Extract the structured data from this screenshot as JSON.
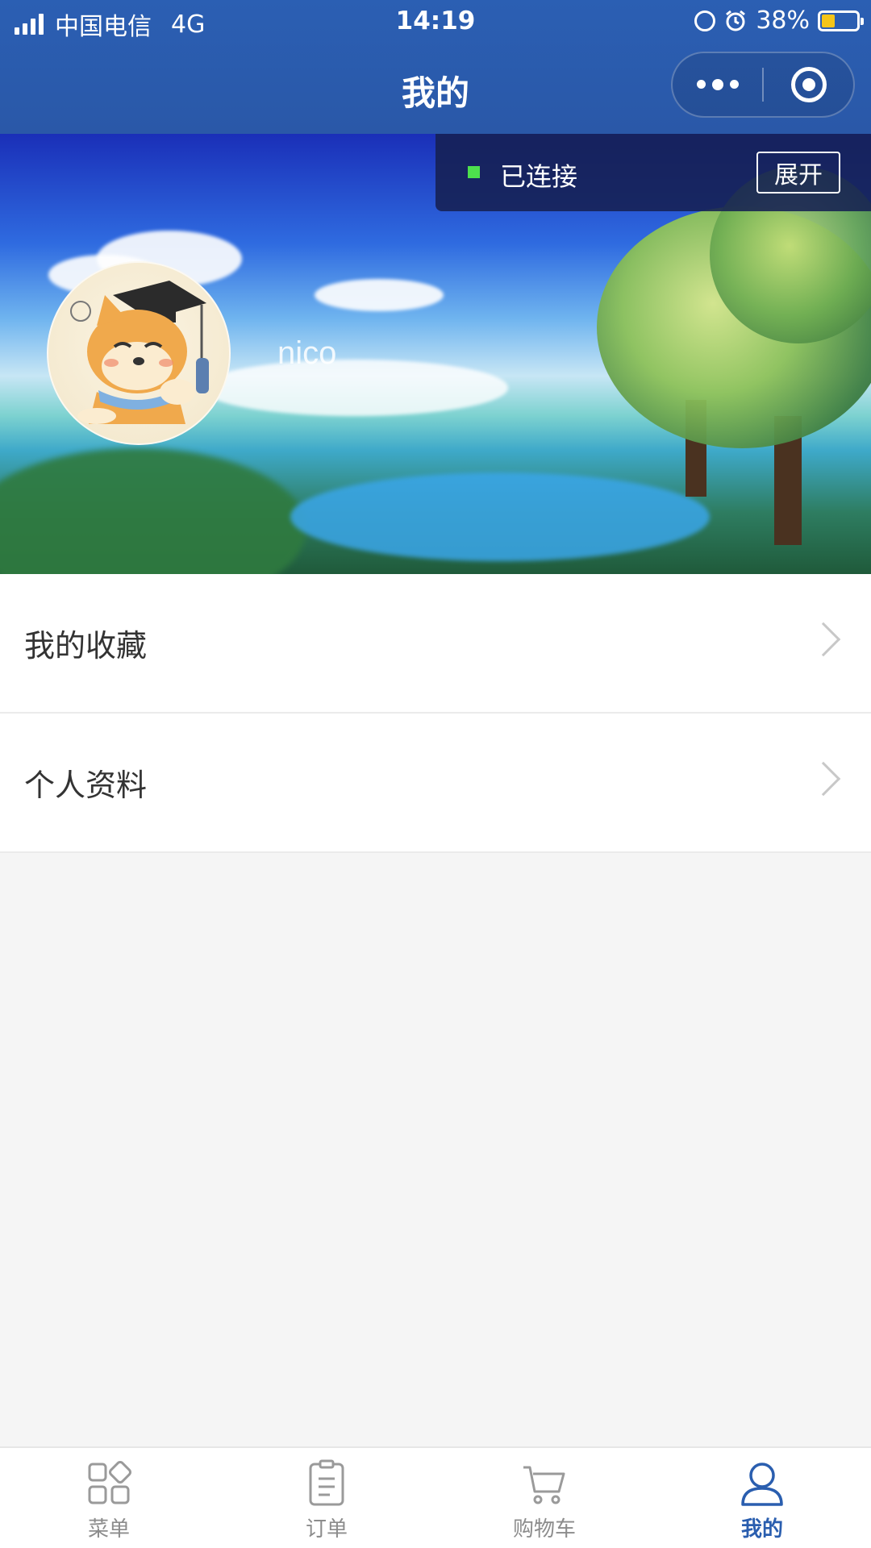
{
  "status_bar": {
    "carrier": "中国电信",
    "network": "4G",
    "time": "14:19",
    "battery": "38%",
    "battery_level": 0.38
  },
  "nav": {
    "title": "我的"
  },
  "connection": {
    "status": "已连接",
    "expand_label": "展开"
  },
  "profile": {
    "username": "nico"
  },
  "menu": {
    "items": [
      {
        "label": "我的收藏"
      },
      {
        "label": "个人资料"
      }
    ]
  },
  "tabbar": {
    "items": [
      {
        "label": "菜单",
        "icon": "grid-icon"
      },
      {
        "label": "订单",
        "icon": "clipboard-icon"
      },
      {
        "label": "购物车",
        "icon": "cart-icon"
      },
      {
        "label": "我的",
        "icon": "user-icon"
      }
    ],
    "active_index": 3
  },
  "colors": {
    "primary": "#2a5eaf",
    "connection_dot": "#4de04d",
    "battery_fill": "#f5c518"
  }
}
